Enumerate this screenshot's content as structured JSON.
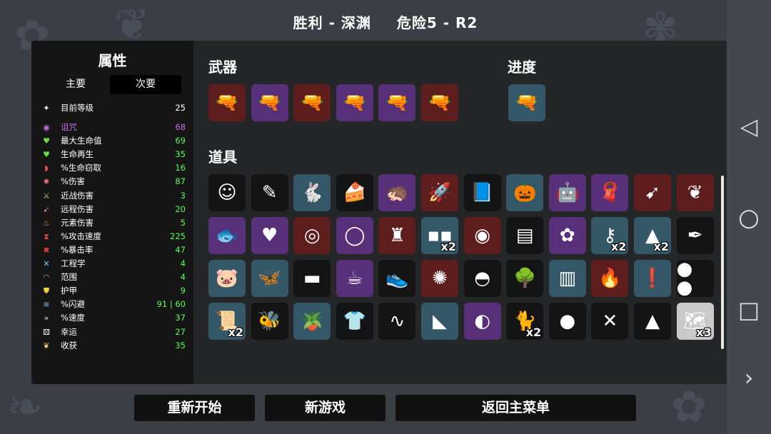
{
  "header": {
    "result": "胜利 - 深渊",
    "danger": "危险5 - R2"
  },
  "stats": {
    "title": "属性",
    "tab_primary": "主要",
    "tab_secondary": "次要",
    "rows": [
      {
        "icon": "level-icon",
        "glyph": "✦",
        "name": "目前等级",
        "value": "25",
        "kind": "lvl"
      },
      {
        "icon": "curse-icon",
        "glyph": "◉",
        "name": "诅咒",
        "value": "68",
        "kind": "curse"
      },
      {
        "icon": "heart-icon",
        "glyph": "♥",
        "name": "最大生命值",
        "value": "69",
        "kind": "pos"
      },
      {
        "icon": "heart-regen-icon",
        "glyph": "♥",
        "name": "生命再生",
        "value": "35",
        "kind": "pos"
      },
      {
        "icon": "lifesteal-icon",
        "glyph": "◗",
        "name": "%生命窃取",
        "value": "16",
        "kind": "pos"
      },
      {
        "icon": "damage-icon",
        "glyph": "✸",
        "name": "%伤害",
        "value": "87",
        "kind": "pos"
      },
      {
        "icon": "sword-icon",
        "glyph": "⚔",
        "name": "近战伤害",
        "value": "3",
        "kind": "pos"
      },
      {
        "icon": "bow-icon",
        "glyph": "➹",
        "name": "远程伤害",
        "value": "20",
        "kind": "pos"
      },
      {
        "icon": "flame-icon",
        "glyph": "♨",
        "name": "元素伤害",
        "value": "5",
        "kind": "pos"
      },
      {
        "icon": "hourglass-icon",
        "glyph": "⧗",
        "name": "%攻击速度",
        "value": "225",
        "kind": "pos"
      },
      {
        "icon": "crit-icon",
        "glyph": "✖",
        "name": "%暴击率",
        "value": "47",
        "kind": "pos"
      },
      {
        "icon": "wrench-icon",
        "glyph": "✕",
        "name": "工程学",
        "value": "4",
        "kind": "pos"
      },
      {
        "icon": "range-icon",
        "glyph": "◠",
        "name": "范围",
        "value": "4",
        "kind": "pos"
      },
      {
        "icon": "shield-icon",
        "glyph": "⛊",
        "name": "护甲",
        "value": "9",
        "kind": "pos"
      },
      {
        "icon": "dodge-icon",
        "glyph": "≋",
        "name": "%闪避",
        "value": "91 | 60",
        "kind": "pos"
      },
      {
        "icon": "speed-icon",
        "glyph": "»",
        "name": "%速度",
        "value": "37",
        "kind": "pos"
      },
      {
        "icon": "dice-icon",
        "glyph": "⚄",
        "name": "幸运",
        "value": "27",
        "kind": "pos"
      },
      {
        "icon": "harvest-icon",
        "glyph": "❦",
        "name": "收获",
        "value": "35",
        "kind": "pos"
      }
    ]
  },
  "weapons": {
    "title": "武器",
    "items": [
      {
        "name": "revolver-icon",
        "tier": "red",
        "glyph": "🔫"
      },
      {
        "name": "revolver-icon",
        "tier": "purple",
        "glyph": "🔫"
      },
      {
        "name": "revolver-icon",
        "tier": "red",
        "glyph": "🔫"
      },
      {
        "name": "revolver-icon",
        "tier": "purple",
        "glyph": "🔫"
      },
      {
        "name": "revolver-icon",
        "tier": "purple",
        "glyph": "🔫"
      },
      {
        "name": "revolver-icon",
        "tier": "red",
        "glyph": "🔫"
      }
    ]
  },
  "progress": {
    "title": "进度",
    "items": [
      {
        "name": "blunderbuss-icon",
        "tier": "blue",
        "glyph": "🔫"
      }
    ]
  },
  "items": {
    "title": "道具",
    "rows": [
      [
        {
          "name": "mask-face-icon",
          "tier": "dark",
          "glyph": "☺"
        },
        {
          "name": "syringe-icon",
          "tier": "dark",
          "glyph": "✎"
        },
        {
          "name": "rabbit-icon",
          "tier": "blue",
          "glyph": "🐇"
        },
        {
          "name": "cake-icon",
          "tier": "dark",
          "glyph": "🍰"
        },
        {
          "name": "hedgehog-icon",
          "tier": "purple",
          "glyph": "🦔"
        },
        {
          "name": "rockets-icon",
          "tier": "red",
          "glyph": "🚀"
        },
        {
          "name": "book-icon",
          "tier": "dark",
          "glyph": "📘"
        },
        {
          "name": "pumpkin-icon",
          "tier": "blue",
          "glyph": "🎃"
        },
        {
          "name": "robot-icon",
          "tier": "purple",
          "glyph": "🤖"
        },
        {
          "name": "scarf-icon",
          "tier": "purple",
          "glyph": "🧣"
        },
        {
          "name": "bullet-icon",
          "tier": "red",
          "glyph": "➹"
        },
        {
          "name": "stomach-icon",
          "tier": "red",
          "glyph": "❦"
        }
      ],
      [
        {
          "name": "fish-icon",
          "tier": "purple",
          "glyph": "🐟"
        },
        {
          "name": "frozen-heart-icon",
          "tier": "purple",
          "glyph": "♥"
        },
        {
          "name": "binoculars-icon",
          "tier": "red",
          "glyph": "◎"
        },
        {
          "name": "pendant-icon",
          "tier": "purple",
          "glyph": "◯"
        },
        {
          "name": "cape-icon",
          "tier": "red",
          "glyph": "♜"
        },
        {
          "name": "glasses-icon",
          "tier": "blue",
          "glyph": "▪▪",
          "count": "x2"
        },
        {
          "name": "collar-icon",
          "tier": "red",
          "glyph": "◉"
        },
        {
          "name": "armor-icon",
          "tier": "dark",
          "glyph": "▤"
        },
        {
          "name": "brain-icon",
          "tier": "purple",
          "glyph": "✿"
        },
        {
          "name": "key-icon",
          "tier": "blue",
          "glyph": "⚷",
          "count": "x2"
        },
        {
          "name": "missile-icon",
          "tier": "blue",
          "glyph": "▲",
          "count": "x2"
        },
        {
          "name": "feather-icon",
          "tier": "dark",
          "glyph": "✒"
        }
      ],
      [
        {
          "name": "pig-icon",
          "tier": "blue",
          "glyph": "🐷"
        },
        {
          "name": "butterfly-icon",
          "tier": "blue",
          "glyph": "🦋"
        },
        {
          "name": "scarf-dark-icon",
          "tier": "dark",
          "glyph": "▬"
        },
        {
          "name": "cup-icon",
          "tier": "purple",
          "glyph": "☕"
        },
        {
          "name": "shoe-icon",
          "tier": "dark",
          "glyph": "👟"
        },
        {
          "name": "lightning-orb-icon",
          "tier": "red",
          "glyph": "✺"
        },
        {
          "name": "beanie-icon",
          "tier": "dark",
          "glyph": "◓"
        },
        {
          "name": "tree-icon",
          "tier": "dark",
          "glyph": "🌳"
        },
        {
          "name": "barrel-icon",
          "tier": "blue",
          "glyph": "▥"
        },
        {
          "name": "torch-icon",
          "tier": "red",
          "glyph": "🔥"
        },
        {
          "name": "alien-pile-icon",
          "tier": "blue",
          "glyph": "❗"
        },
        {
          "name": "eyes-icon",
          "tier": "dark",
          "glyph": "● ●"
        }
      ],
      [
        {
          "name": "scroll-icon",
          "tier": "blue",
          "glyph": "📜",
          "count": "x2"
        },
        {
          "name": "bee-icon",
          "tier": "dark",
          "glyph": "🐝"
        },
        {
          "name": "plant-pot-icon",
          "tier": "blue",
          "glyph": "🪴"
        },
        {
          "name": "hoodie-icon",
          "tier": "dark",
          "glyph": "👕"
        },
        {
          "name": "worm-icon",
          "tier": "dark",
          "glyph": "∿"
        },
        {
          "name": "horn-icon",
          "tier": "blue",
          "glyph": "◣"
        },
        {
          "name": "hermit-crab-icon",
          "tier": "purple",
          "glyph": "◐"
        },
        {
          "name": "cat-icon",
          "tier": "dark",
          "glyph": "🐈",
          "count": "x2"
        },
        {
          "name": "snowball-icon",
          "tier": "dark",
          "glyph": "●"
        },
        {
          "name": "cross-stick-icon",
          "tier": "dark",
          "glyph": "✕"
        },
        {
          "name": "rocket-shoe-icon",
          "tier": "dark",
          "glyph": "▲"
        },
        {
          "name": "treasure-map-icon",
          "tier": "light",
          "glyph": "🗺",
          "count": "x3"
        }
      ]
    ]
  },
  "buttons": {
    "restart": "重新开始",
    "new_game": "新游戏",
    "main_menu": "返回主菜单"
  },
  "nav": {
    "back": "◁",
    "home": "○",
    "recent": "□",
    "expand": "›"
  }
}
